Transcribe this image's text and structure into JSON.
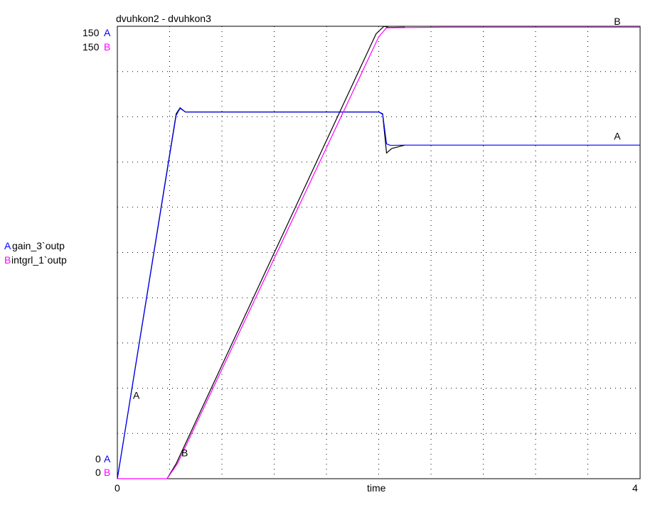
{
  "chart_data": {
    "type": "line",
    "title": "dvuhkon2 - dvuhkon3",
    "xlabel": "time",
    "xlim": [
      0,
      4
    ],
    "x_tick_labels": [
      "0",
      "4"
    ],
    "ylim": [
      0,
      150
    ],
    "y_axis_labels": [
      {
        "value": "150",
        "marker": "A"
      },
      {
        "value": "150",
        "marker": "B"
      },
      {
        "value": "0",
        "marker": "A"
      },
      {
        "value": "0",
        "marker": "B"
      }
    ],
    "grid": true,
    "legend": [
      {
        "marker": "A",
        "label": "gain_3`outp"
      },
      {
        "marker": "B",
        "label": "intgrl_1`outp"
      }
    ],
    "colors": {
      "A": "#0000ff",
      "B": "#ff00ff",
      "reference": "#000000",
      "grid": "#000000"
    },
    "series": [
      {
        "name": "gain_3`outp",
        "marker": "A",
        "points": [
          [
            0,
            0
          ],
          [
            0.45,
            120.5
          ],
          [
            0.48,
            122.8
          ],
          [
            0.52,
            121.6
          ],
          [
            2.0,
            121.6
          ],
          [
            2.03,
            121.0
          ],
          [
            2.06,
            111.0
          ],
          [
            2.09,
            110.5
          ],
          [
            2.2,
            110.6
          ],
          [
            4.0,
            110.6
          ]
        ]
      },
      {
        "name": "intgrl_1`outp",
        "marker": "B",
        "points": [
          [
            0,
            0
          ],
          [
            0.38,
            0
          ],
          [
            0.46,
            5
          ],
          [
            2.0,
            146.5
          ],
          [
            2.06,
            149.5
          ],
          [
            2.5,
            149.7
          ],
          [
            4.0,
            149.7
          ]
        ]
      },
      {
        "name": "",
        "marker": "ref",
        "points": [
          [
            0,
            0
          ],
          [
            0.45,
            121.0
          ],
          [
            0.48,
            123.0
          ],
          [
            0.52,
            121.6
          ],
          [
            2.0,
            121.6
          ],
          [
            2.03,
            120.8
          ],
          [
            2.06,
            108.0
          ],
          [
            2.1,
            109.5
          ],
          [
            2.2,
            110.6
          ]
        ]
      },
      {
        "name": "",
        "marker": "ref",
        "points": [
          [
            0.38,
            0
          ],
          [
            0.45,
            5
          ],
          [
            1.98,
            147.5
          ],
          [
            2.04,
            150.0
          ],
          [
            2.08,
            149.6
          ],
          [
            2.2,
            149.7
          ]
        ]
      }
    ],
    "curve_labels": [
      {
        "text": "A",
        "x": 0.12,
        "y": 26
      },
      {
        "text": "B",
        "x": 0.49,
        "y": 7
      },
      {
        "text": "B",
        "x": 3.8,
        "y": 150
      },
      {
        "text": "A",
        "x": 3.8,
        "y": 112
      }
    ]
  }
}
